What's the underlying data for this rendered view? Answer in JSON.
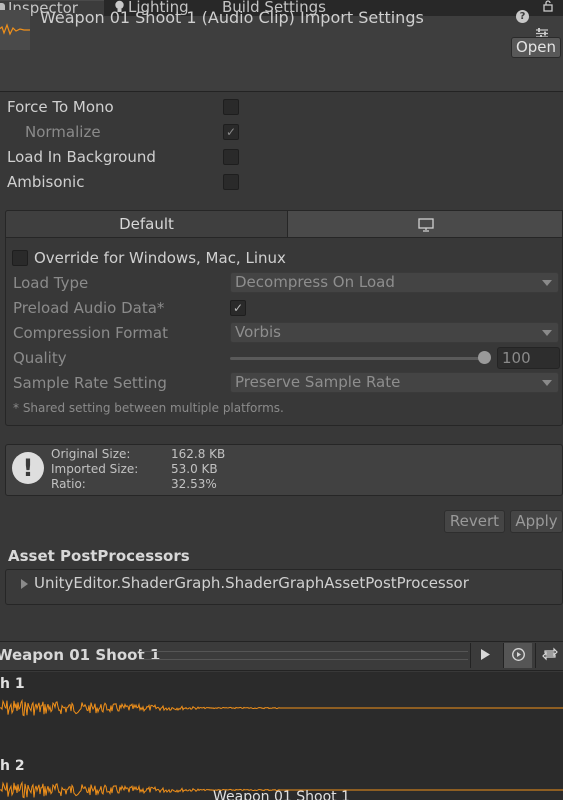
{
  "tabs": [
    {
      "label": "Inspector"
    },
    {
      "label": "Lighting"
    },
    {
      "label": "Build Settings"
    }
  ],
  "header": {
    "title": "Weapon 01 Shoot 1 (Audio Clip) Import Settings",
    "open_label": "Open"
  },
  "properties": {
    "force_to_mono": {
      "label": "Force To Mono",
      "checked": false
    },
    "normalize": {
      "label": "Normalize",
      "checked": true
    },
    "load_in_background": {
      "label": "Load In Background",
      "checked": false
    },
    "ambisonic": {
      "label": "Ambisonic",
      "checked": false
    }
  },
  "platform": {
    "default_tab": "Default",
    "override_label": "Override for Windows, Mac, Linux",
    "load_type": {
      "label": "Load Type",
      "value": "Decompress On Load"
    },
    "preload": {
      "label": "Preload Audio Data*",
      "checked": true
    },
    "compression": {
      "label": "Compression Format",
      "value": "Vorbis"
    },
    "quality": {
      "label": "Quality",
      "value": "100",
      "level": 1.0
    },
    "sample_rate": {
      "label": "Sample Rate Setting",
      "value": "Preserve Sample Rate"
    },
    "note": "* Shared setting between multiple platforms."
  },
  "info": {
    "original_label": "Original Size:",
    "original_value": "162.8 KB",
    "imported_label": "Imported Size:",
    "imported_value": "53.0 KB",
    "ratio_label": "Ratio:",
    "ratio_value": "32.53%"
  },
  "actions": {
    "revert": "Revert",
    "apply": "Apply"
  },
  "postprocessors": {
    "title": "Asset PostProcessors",
    "item": "UnityEditor.ShaderGraph.ShaderGraphAssetPostProcessor"
  },
  "preview": {
    "title": "Weapon 01 Shoot 1",
    "channels": [
      "h 1",
      "h 2"
    ],
    "footer": "Weapon 01 Shoot 1",
    "wave_color": "#f0901a"
  },
  "colors": {
    "accent": "#f0901a",
    "background": "#383838"
  },
  "icons": [
    "lock-icon",
    "more-options-icon",
    "help-icon",
    "preset-icon",
    "lightbulb-icon",
    "monitor-icon",
    "warning-icon",
    "play-icon",
    "auto-play-icon",
    "loop-icon"
  ]
}
